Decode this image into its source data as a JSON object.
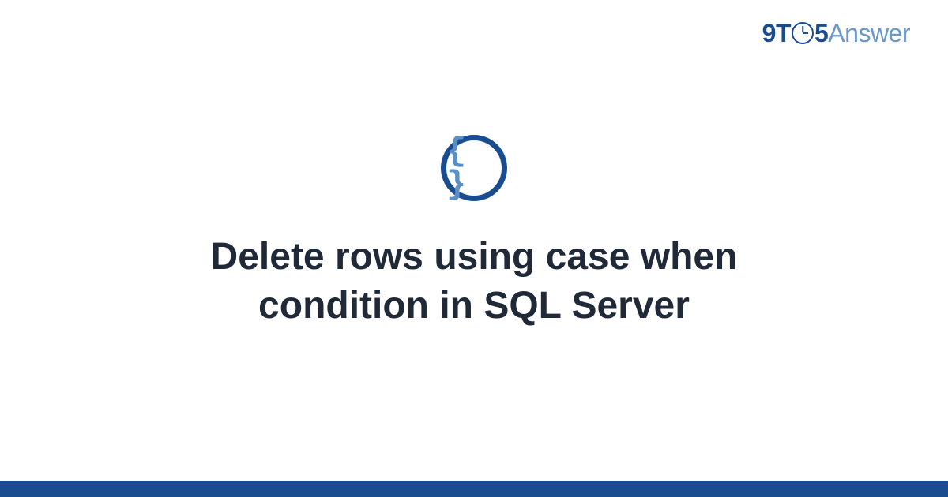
{
  "brand": {
    "prefix": "9T",
    "suffix": "5",
    "word": "Answer"
  },
  "icon": {
    "name": "code-braces-icon",
    "glyph": "{ }"
  },
  "title": "Delete rows using case when condition in SQL Server",
  "colors": {
    "primary": "#1a4d8f",
    "accent": "#5b8fc7",
    "text": "#1f2937"
  }
}
